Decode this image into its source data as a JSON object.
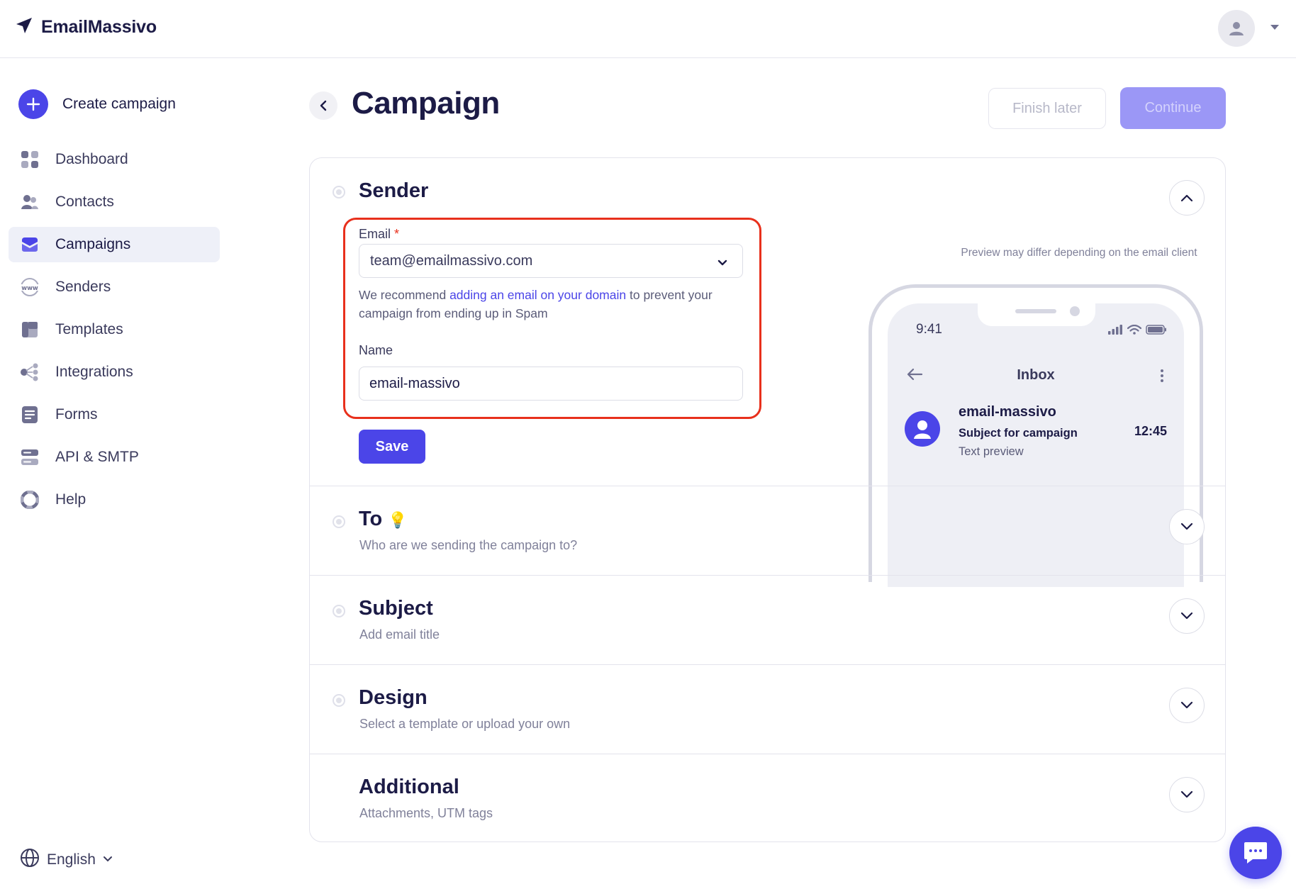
{
  "app": {
    "name": "EmailMassivo"
  },
  "sidebar": {
    "create_label": "Create campaign",
    "items": [
      {
        "label": "Dashboard",
        "icon": "dashboard-icon"
      },
      {
        "label": "Contacts",
        "icon": "contacts-icon"
      },
      {
        "label": "Campaigns",
        "icon": "campaigns-icon",
        "active": true
      },
      {
        "label": "Senders",
        "icon": "www-icon"
      },
      {
        "label": "Templates",
        "icon": "templates-icon"
      },
      {
        "label": "Integrations",
        "icon": "integrations-icon"
      },
      {
        "label": "Forms",
        "icon": "forms-icon"
      },
      {
        "label": "API & SMTP",
        "icon": "server-icon"
      },
      {
        "label": "Help",
        "icon": "lifebuoy-icon"
      }
    ],
    "language": "English"
  },
  "header": {
    "title": "Campaign",
    "finish_label": "Finish later",
    "continue_label": "Continue"
  },
  "sender": {
    "title": "Sender",
    "email_label": "Email",
    "required_mark": "*",
    "email_value": "team@emailmassivo.com",
    "help_before": "We recommend ",
    "help_link": "adding an email on your domain",
    "help_after": " to prevent your campaign from ending up in Spam",
    "name_label": "Name",
    "name_value": "email-massivo",
    "save_label": "Save"
  },
  "preview": {
    "note": "Preview may differ depending on the email client",
    "time": "9:41",
    "inbox_title": "Inbox",
    "from": "email-massivo",
    "subject": "Subject for campaign",
    "text": "Text preview",
    "mail_time": "12:45"
  },
  "sections": {
    "to": {
      "title": "To",
      "emoji": "💡",
      "subtitle": "Who are we sending the campaign to?"
    },
    "subject": {
      "title": "Subject",
      "subtitle": "Add email title"
    },
    "design": {
      "title": "Design",
      "subtitle": "Select a template or upload your own"
    },
    "additional": {
      "title": "Additional",
      "subtitle": "Attachments, UTM tags"
    }
  },
  "colors": {
    "accent": "#4b45e8",
    "highlight": "#e8301c",
    "text": "#1c1b46"
  }
}
